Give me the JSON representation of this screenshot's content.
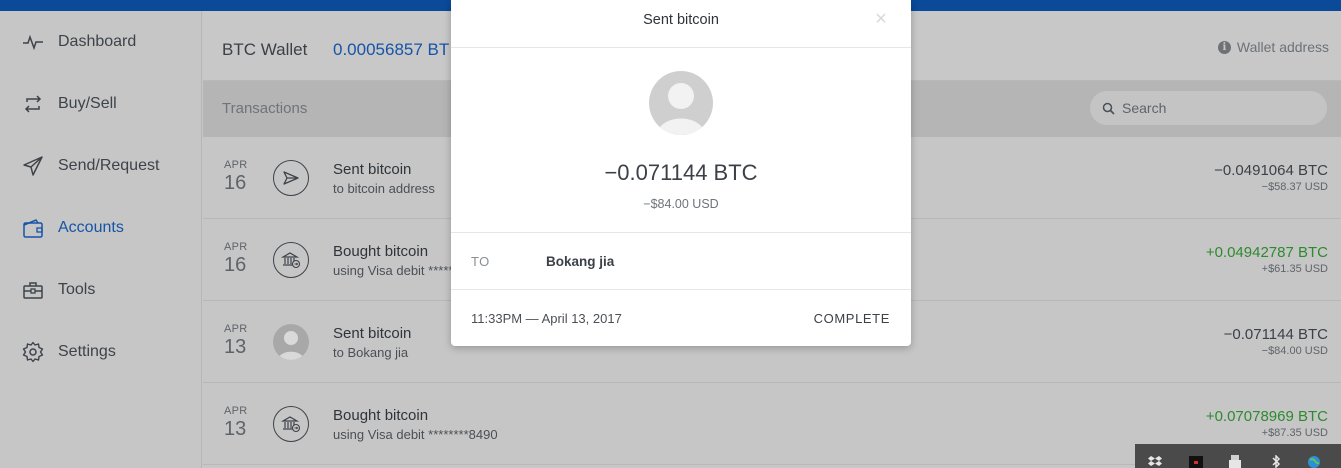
{
  "topbar": {
    "color": "#0a4a99"
  },
  "sidebar": {
    "items": [
      {
        "label": "Dashboard",
        "icon": "pulse-icon",
        "active": false
      },
      {
        "label": "Buy/Sell",
        "icon": "exchange-icon",
        "active": false
      },
      {
        "label": "Send/Request",
        "icon": "paper-plane-icon",
        "active": false
      },
      {
        "label": "Accounts",
        "icon": "wallet-icon",
        "active": true
      },
      {
        "label": "Tools",
        "icon": "toolbox-icon",
        "active": false
      },
      {
        "label": "Settings",
        "icon": "gear-icon",
        "active": false
      }
    ]
  },
  "wallet": {
    "title": "BTC Wallet",
    "balance": "0.00056857 BT",
    "address_label": "Wallet address"
  },
  "transactions": {
    "title": "Transactions",
    "search_placeholder": "Search",
    "rows": [
      {
        "month": "APR",
        "day": "16",
        "title": "Sent bitcoin",
        "subtitle": "to bitcoin address",
        "amount": "−0.0491064 BTC",
        "fiat": "−$58.37 USD",
        "icon": "paper-plane-icon",
        "positive": false
      },
      {
        "month": "APR",
        "day": "16",
        "title": "Bought bitcoin",
        "subtitle": "using Visa debit ********",
        "amount": "+0.04942787 BTC",
        "fiat": "+$61.35 USD",
        "icon": "bank-icon",
        "positive": true
      },
      {
        "month": "APR",
        "day": "13",
        "title": "Sent bitcoin",
        "subtitle": "to Bokang jia",
        "amount": "−0.071144 BTC",
        "fiat": "−$84.00 USD",
        "icon": "user-avatar",
        "positive": false
      },
      {
        "month": "APR",
        "day": "13",
        "title": "Bought bitcoin",
        "subtitle": "using Visa debit ********8490",
        "amount": "+0.07078969 BTC",
        "fiat": "+$87.35 USD",
        "icon": "bank-icon",
        "positive": true
      }
    ]
  },
  "modal": {
    "title": "Sent bitcoin",
    "close_glyph": "×",
    "btc_amount": "−0.071144 BTC",
    "usd_amount": "−$84.00 USD",
    "to_label": "TO",
    "to_name": "Bokang jia",
    "datetime": "11:33PM — April 13, 2017",
    "status": "COMPLETE"
  },
  "colors": {
    "accent": "#1654a8",
    "positive": "#2e8a2e",
    "overlay": "#c6c6c6"
  }
}
